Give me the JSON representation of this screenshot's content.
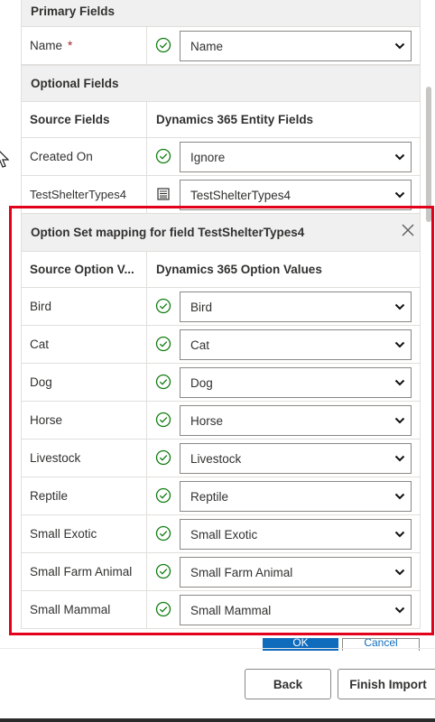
{
  "primary": {
    "header": "Primary Fields",
    "row": {
      "label": "Name",
      "required_mark": "*",
      "value": "Name"
    }
  },
  "optional": {
    "header": "Optional Fields",
    "col_source": "Source Fields",
    "col_target": "Dynamics 365 Entity Fields",
    "rows": [
      {
        "label": "Created On",
        "value": "Ignore",
        "status_icon": "checkmark-circle-icon"
      },
      {
        "label": "TestShelterTypes4",
        "value": "TestShelterTypes4",
        "status_icon": "option-set-list-icon"
      }
    ]
  },
  "option_set": {
    "title": "Option Set mapping for field TestShelterTypes4",
    "close_icon": "close-icon",
    "col_source": "Source Option V...",
    "col_target": "Dynamics 365 Option Values",
    "rows": [
      {
        "label": "Bird",
        "value": "Bird"
      },
      {
        "label": "Cat",
        "value": "Cat"
      },
      {
        "label": "Dog",
        "value": "Dog"
      },
      {
        "label": "Horse",
        "value": "Horse"
      },
      {
        "label": "Livestock",
        "value": "Livestock"
      },
      {
        "label": "Reptile",
        "value": "Reptile"
      },
      {
        "label": "Small Exotic",
        "value": "Small Exotic"
      },
      {
        "label": "Small Farm Animal",
        "value": "Small Farm Animal"
      },
      {
        "label": "Small Mammal",
        "value": "Small Mammal"
      }
    ],
    "ok_label": "OK",
    "cancel_label": "Cancel"
  },
  "footer": {
    "back_label": "Back",
    "finish_label": "Finish Import"
  },
  "colors": {
    "accent": "#0f6cbd",
    "success": "#107c10",
    "highlight": "#e3001b",
    "required": "#a4262c"
  }
}
